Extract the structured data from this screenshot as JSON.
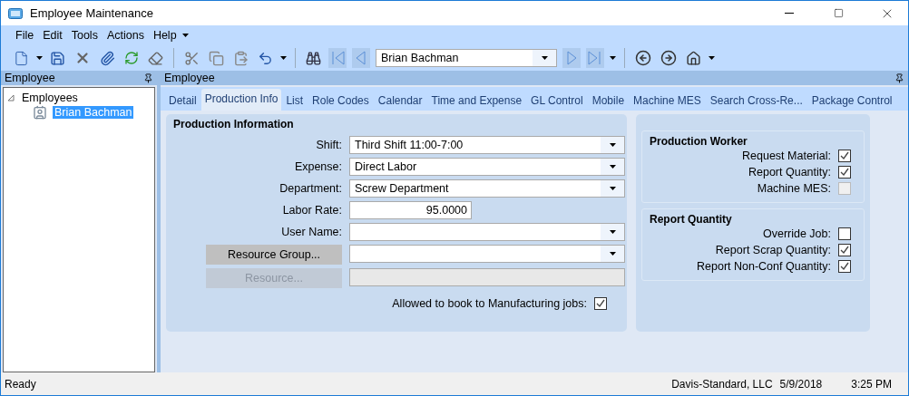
{
  "window": {
    "title": "Employee Maintenance"
  },
  "menu": [
    "File",
    "Edit",
    "Tools",
    "Actions",
    "Help"
  ],
  "toolbar": {
    "record_combo": {
      "value": "Brian Bachman"
    },
    "nav": [
      {
        "kind": "first",
        "disabled": true
      },
      {
        "kind": "prev",
        "disabled": true
      }
    ],
    "nav_after": [
      {
        "kind": "next",
        "disabled": true
      },
      {
        "kind": "last",
        "disabled": true
      }
    ]
  },
  "left_panel": {
    "title": "Employee",
    "tree": [
      {
        "label": "Employees",
        "expanded": true,
        "selected": false,
        "children": [
          {
            "label": "Brian Bachman",
            "selected": true
          }
        ]
      }
    ]
  },
  "main_panel": {
    "title": "Employee",
    "tabs": [
      {
        "label": "Detail",
        "selected": false
      },
      {
        "label": "Production Info",
        "selected": true
      },
      {
        "label": "List",
        "selected": false
      },
      {
        "label": "Role Codes",
        "selected": false
      },
      {
        "label": "Calendar",
        "selected": false
      },
      {
        "label": "Time and Expense",
        "selected": false
      },
      {
        "label": "GL Control",
        "selected": false
      },
      {
        "label": "Mobile",
        "selected": false
      },
      {
        "label": "Machine MES",
        "selected": false
      },
      {
        "label": "Search Cross-Re...",
        "selected": false
      },
      {
        "label": "Package Control",
        "selected": false
      }
    ]
  },
  "production_info": {
    "title": "Production Information",
    "fields": [
      {
        "kind": "combo",
        "label": "Shift:",
        "value": "Third Shift 11:00-7:00"
      },
      {
        "kind": "combo",
        "label": "Expense:",
        "value": "Direct Labor"
      },
      {
        "kind": "combo",
        "label": "Department:",
        "value": "Screw Department"
      },
      {
        "kind": "number",
        "label": "Labor Rate:",
        "value": "95.0000"
      },
      {
        "kind": "combo",
        "label": "User Name:"
      },
      {
        "kind": "lookup",
        "label": "Resource Group...",
        "disabled": false
      },
      {
        "kind": "lookup",
        "label": "Resource...",
        "disabled": true
      }
    ],
    "allowed": {
      "label": "Allowed to book to Manufacturing jobs:",
      "checked": true
    }
  },
  "groups": [
    {
      "title": "Production Worker",
      "checks": [
        {
          "label": "Request Material:",
          "checked": true,
          "disabled": false
        },
        {
          "label": "Report Quantity:",
          "checked": true,
          "disabled": false
        },
        {
          "label": "Machine MES:",
          "checked": false,
          "disabled": true
        }
      ]
    },
    {
      "title": "Report Quantity",
      "checks": [
        {
          "label": "Override Job:",
          "checked": false,
          "disabled": false
        },
        {
          "label": "Report Scrap Quantity:",
          "checked": true,
          "disabled": false
        },
        {
          "label": "Report Non-Conf Quantity:",
          "checked": true,
          "disabled": false
        }
      ]
    }
  ],
  "status_bar": {
    "message": "Ready",
    "company": "Davis-Standard, LLC",
    "date": "5/9/2018",
    "time": "3:25 PM"
  }
}
